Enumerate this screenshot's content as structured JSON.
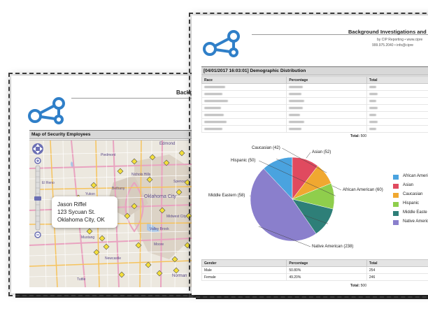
{
  "back_page": {
    "header_title": "Backgr",
    "section_title": "Map of Security Employees",
    "popup": {
      "name": "Jason Riffel",
      "street": "123 Sycuan St.",
      "city": "Oklahoma City, OK"
    },
    "map_labels": {
      "edmond": "Edmond",
      "oklahoma_city": "Oklahoma City",
      "el_reno": "El Reno",
      "yukon": "Yukon",
      "mustang": "Mustang",
      "norman": "Norman",
      "moore": "Moore",
      "piedmont": "Piedmont",
      "bethany": "Bethany",
      "midwest_city": "Midwest City",
      "newcastle": "Newcastle",
      "spencer": "Spencer",
      "nichols_hills": "Nichols Hills",
      "tuttle": "Tuttle",
      "valley_brook": "Valley Brook"
    },
    "zoom_controls": {
      "plus": "+",
      "minus": "−"
    }
  },
  "front_page": {
    "report_title": "Background Investigations and Lic",
    "subtitle_line1": "by CIP Reporting • www.cipre",
    "subtitle_line2": "999.975.2040 • info@cipre",
    "section_title": "[04/01/2017 16:03:01] Demographic Distribution",
    "race_table": {
      "headers": [
        "Race",
        "Percentage",
        "Total"
      ],
      "rows": 7,
      "total_label": "Total:",
      "total_value": "500"
    },
    "gender_table": {
      "headers": [
        "Gender",
        "Percentage",
        "Total"
      ],
      "rows": [
        {
          "gender": "Male",
          "percentage": "50.80%",
          "total": "254"
        },
        {
          "gender": "Female",
          "percentage": "49.20%",
          "total": "246"
        }
      ],
      "total_label": "Total:",
      "total_value": "500"
    }
  },
  "chart_data": {
    "type": "pie",
    "title": "",
    "slices": [
      {
        "name": "African American",
        "label": "African American (60)",
        "value": 60,
        "color": "#4aa3df"
      },
      {
        "name": "Asian",
        "label": "Asian (52)",
        "value": 52,
        "color": "#e04a5f"
      },
      {
        "name": "Caucasian",
        "label": "Caucasian (42)",
        "value": 42,
        "color": "#f0a830"
      },
      {
        "name": "Hispanic",
        "label": "Hispanic (50)",
        "value": 50,
        "color": "#8fce4c"
      },
      {
        "name": "Middle Eastern",
        "label": "Middle Eastern (58)",
        "value": 58,
        "color": "#2e7f78"
      },
      {
        "name": "Native American",
        "label": "Native American (238)",
        "value": 238,
        "color": "#8a7fcc"
      }
    ],
    "legend": {
      "placement": "right",
      "entries": [
        "African Americ",
        "Asian",
        "Caucasian",
        "Hispanic",
        "Middle Easte",
        "Native Americ"
      ]
    }
  },
  "colors": {
    "logo_blue": "#2f7fc8",
    "section_bar": "#d8d8d8",
    "map_marker": "#f3df3a"
  },
  "icons": {
    "logo": "network-node-icon",
    "map_marker": "warning-marker-icon"
  }
}
